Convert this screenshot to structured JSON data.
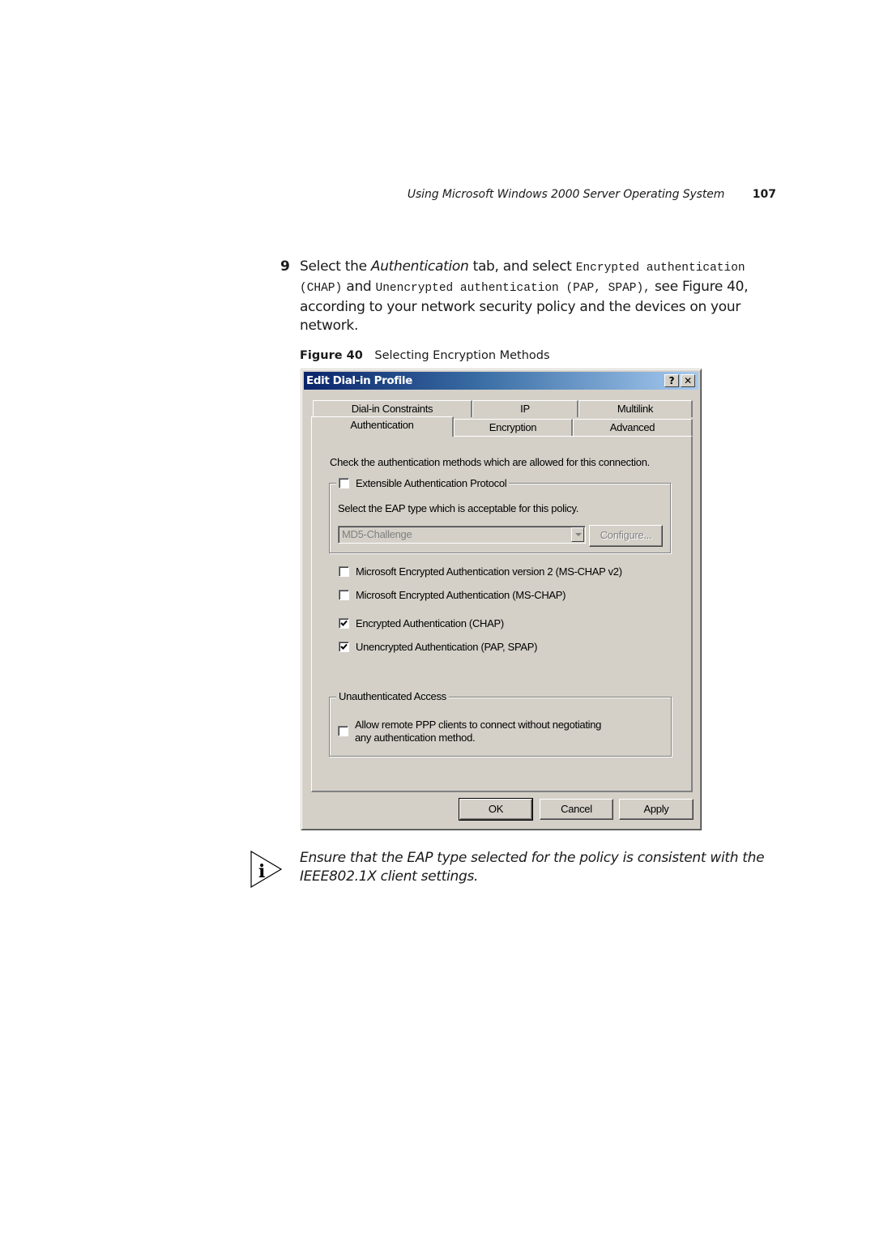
{
  "running_head": {
    "title": "Using Microsoft Windows 2000 Server Operating System",
    "page_number": "107"
  },
  "step": {
    "number": "9",
    "parts": {
      "p1": "Select the ",
      "p2_italic": "Authentication",
      "p3": " tab, and select ",
      "p4_mono": "Encrypted authentication (CHAP)",
      "p5": " and ",
      "p6_mono": "Unencrypted authentication (PAP, SPAP),",
      "p7": " see Figure 40, according to your network security policy and the devices on your network."
    }
  },
  "figure": {
    "label": "Figure 40",
    "caption": "Selecting Encryption Methods"
  },
  "dialog": {
    "title": "Edit Dial-in Profile",
    "help_glyph": "?",
    "close_glyph": "✕",
    "tabs_back_row": [
      {
        "label": "Dial-in Constraints"
      },
      {
        "label": "IP"
      },
      {
        "label": "Multilink"
      }
    ],
    "tabs_front_row": [
      {
        "label": "Authentication",
        "active": true
      },
      {
        "label": "Encryption",
        "active": false
      },
      {
        "label": "Advanced",
        "active": false
      }
    ],
    "intro": "Check the authentication methods which are allowed for this connection.",
    "eap_group": {
      "checkbox_label": "Extensible Authentication Protocol",
      "checked": false,
      "instruction": "Select the EAP type which is acceptable for this policy.",
      "eap_type_value": "MD5-Challenge",
      "configure_label": "Configure..."
    },
    "methods": [
      {
        "label": "Microsoft Encrypted Authentication version 2 (MS-CHAP v2)",
        "checked": false
      },
      {
        "label": "Microsoft Encrypted Authentication (MS-CHAP)",
        "checked": false
      },
      {
        "label": "Encrypted Authentication (CHAP)",
        "checked": true
      },
      {
        "label": "Unencrypted Authentication (PAP, SPAP)",
        "checked": true
      }
    ],
    "unauth_group": {
      "legend": "Unauthenticated Access",
      "checkbox_label_line1": "Allow remote PPP clients to connect without negotiating",
      "checkbox_label_line2": "any authentication method.",
      "checked": false
    },
    "buttons": {
      "ok": "OK",
      "cancel": "Cancel",
      "apply": "Apply"
    }
  },
  "note": {
    "icon": "info-icon",
    "text_line1": "Ensure that the EAP type selected for the policy is consistent with the",
    "text_line2": "IEEE802.1X client settings."
  }
}
